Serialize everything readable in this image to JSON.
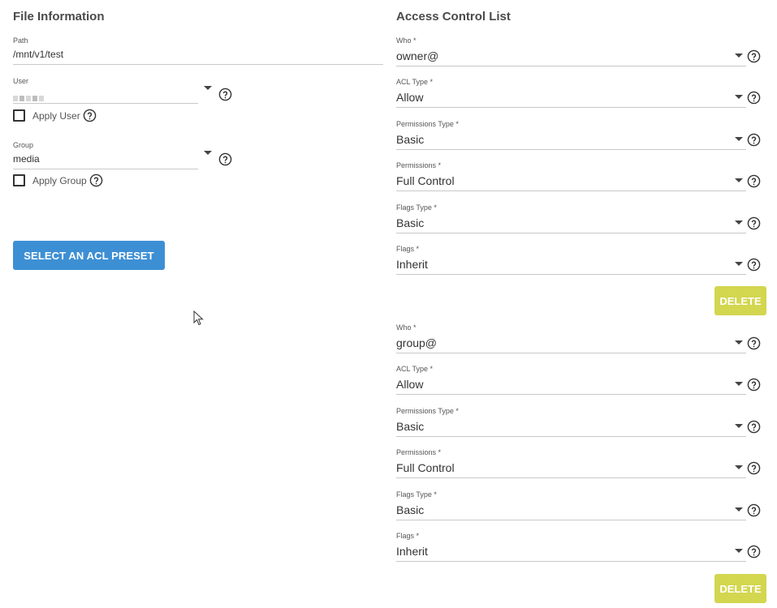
{
  "file_info": {
    "title": "File Information",
    "path": {
      "label": "Path",
      "value": "/mnt/v1/test"
    },
    "user": {
      "label": "User",
      "value": ""
    },
    "apply_user_label": "Apply User",
    "group": {
      "label": "Group",
      "value": "media"
    },
    "apply_group_label": "Apply Group",
    "preset_button": "SELECT AN ACL PRESET"
  },
  "acl": {
    "title": "Access Control List",
    "delete_label": "DELETE",
    "entries": [
      {
        "who": {
          "label": "Who *",
          "value": "owner@"
        },
        "acl_type": {
          "label": "ACL Type *",
          "value": "Allow"
        },
        "permissions_type": {
          "label": "Permissions Type *",
          "value": "Basic"
        },
        "permissions": {
          "label": "Permissions *",
          "value": "Full Control"
        },
        "flags_type": {
          "label": "Flags Type *",
          "value": "Basic"
        },
        "flags": {
          "label": "Flags *",
          "value": "Inherit"
        }
      },
      {
        "who": {
          "label": "Who *",
          "value": "group@"
        },
        "acl_type": {
          "label": "ACL Type *",
          "value": "Allow"
        },
        "permissions_type": {
          "label": "Permissions Type *",
          "value": "Basic"
        },
        "permissions": {
          "label": "Permissions *",
          "value": "Full Control"
        },
        "flags_type": {
          "label": "Flags Type *",
          "value": "Basic"
        },
        "flags": {
          "label": "Flags *",
          "value": "Inherit"
        }
      }
    ]
  },
  "icons": {
    "help": "help-circle-icon",
    "dropdown": "chevron-down-icon",
    "cursor": "mouse-pointer-icon"
  },
  "colors": {
    "primary_button": "#3d8fd4",
    "delete_button": "#d3d64f"
  }
}
